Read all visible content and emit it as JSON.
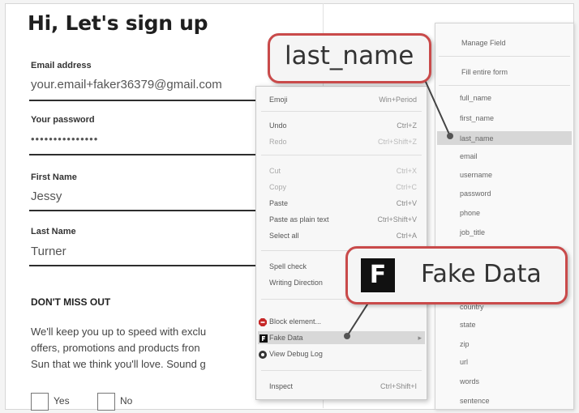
{
  "form": {
    "title": "Hi, Let's sign up",
    "email_label": "Email address",
    "email_value": "your.email+faker36379@gmail.com",
    "password_label": "Your password",
    "password_value": "•••••••••••••••",
    "first_name_label": "First Name",
    "first_name_value": "Jessy",
    "last_name_label": "Last Name",
    "last_name_value": "Turner",
    "section_title": "DON'T MISS OUT",
    "paragraph_lines": [
      "We'll keep you up to speed with exclu",
      "offers, promotions and products fron",
      "Sun that we think you'll love. Sound g"
    ],
    "yes_label": "Yes",
    "no_label": "No"
  },
  "context_menu": {
    "items": [
      {
        "label": "Emoji",
        "shortcut": "Win+Period"
      },
      {
        "label": "Undo",
        "shortcut": "Ctrl+Z"
      },
      {
        "label": "Redo",
        "shortcut": "Ctrl+Shift+Z"
      },
      {
        "label": "Cut",
        "shortcut": "Ctrl+X"
      },
      {
        "label": "Copy",
        "shortcut": "Ctrl+C"
      },
      {
        "label": "Paste",
        "shortcut": "Ctrl+V"
      },
      {
        "label": "Paste as plain text",
        "shortcut": "Ctrl+Shift+V"
      },
      {
        "label": "Select all",
        "shortcut": "Ctrl+A"
      },
      {
        "label": "Spell check",
        "shortcut": ""
      },
      {
        "label": "Writing Direction",
        "shortcut": ""
      },
      {
        "label": "Block element...",
        "shortcut": ""
      },
      {
        "label": "Fake Data",
        "shortcut": "▸"
      },
      {
        "label": "View Debug Log",
        "shortcut": ""
      },
      {
        "label": "Inspect",
        "shortcut": "Ctrl+Shift+I"
      }
    ]
  },
  "submenu": {
    "top_items": [
      "Manage Field",
      "Fill entire form"
    ],
    "items": [
      "full_name",
      "first_name",
      "last_name",
      "email",
      "username",
      "password",
      "phone",
      "job_title",
      "country",
      "state",
      "zip",
      "url",
      "words",
      "sentence"
    ]
  },
  "callouts": {
    "last_name": "last_name",
    "fake_data": "Fake Data",
    "fake_data_logo": "F"
  },
  "colors": {
    "callout_border": "#c94a4a",
    "highlight": "#d8d8d8",
    "block_icon": "#c62828"
  }
}
